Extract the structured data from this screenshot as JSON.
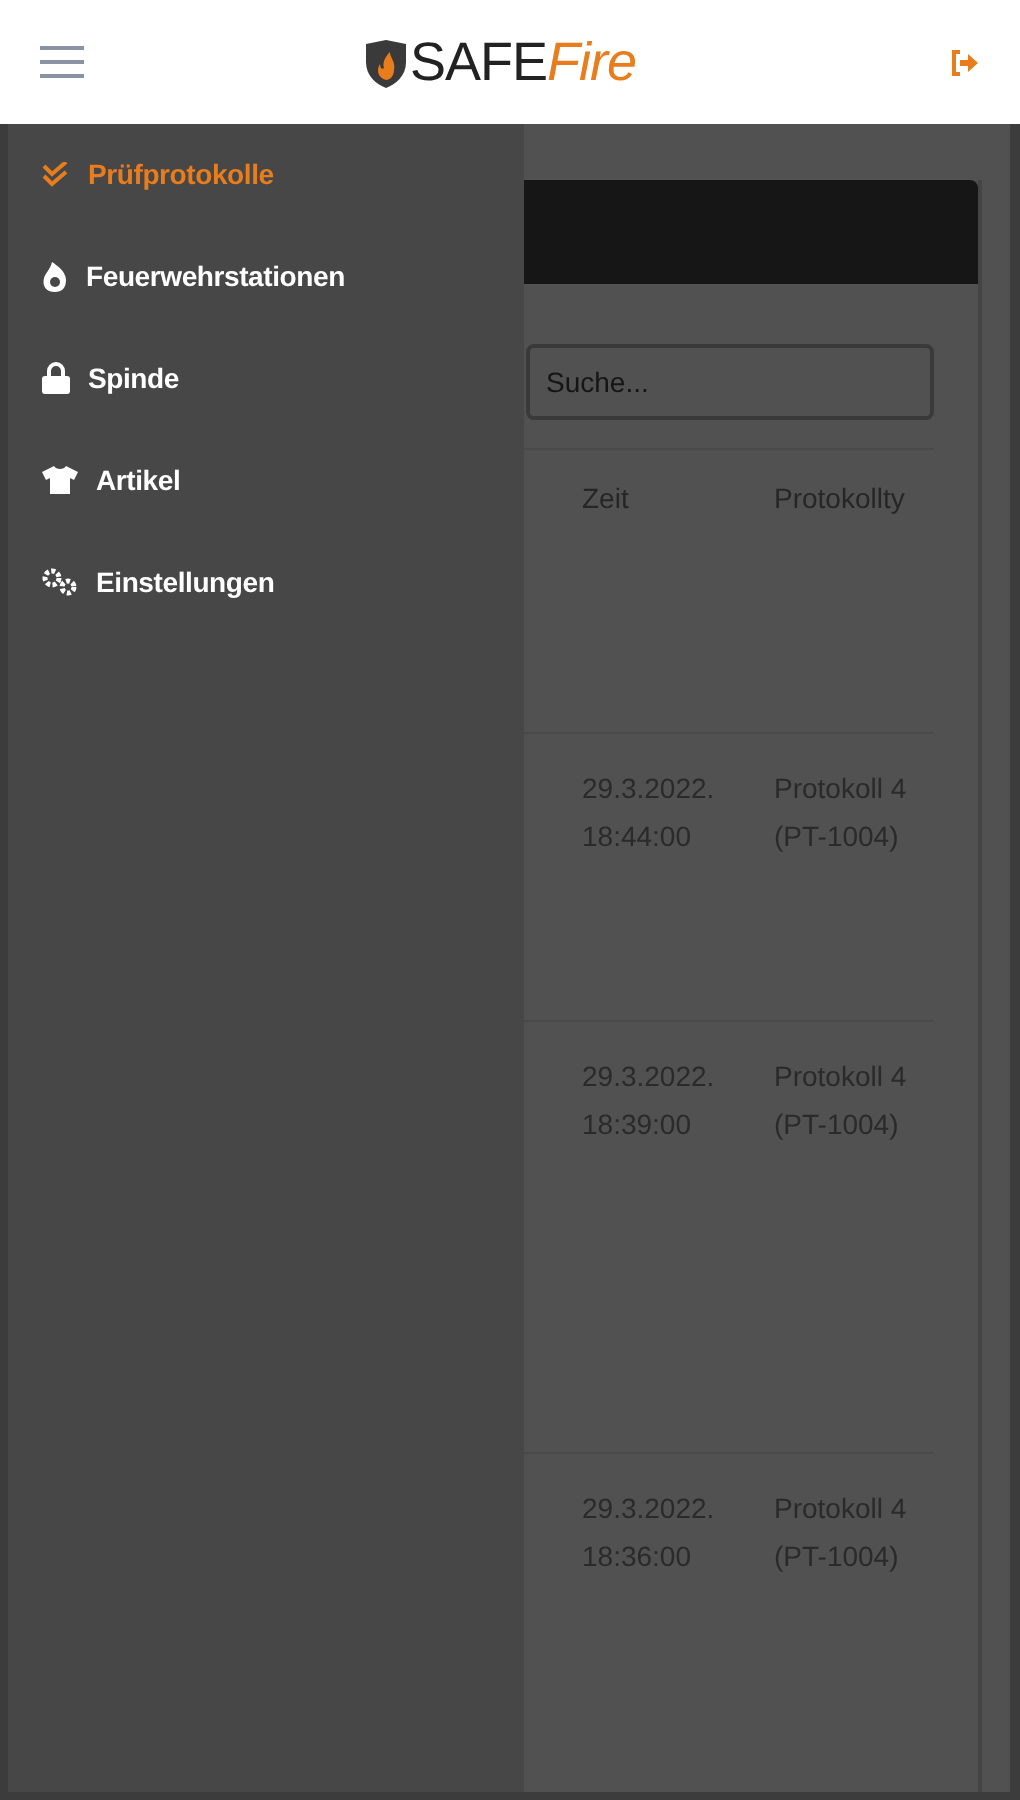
{
  "header": {
    "logo": {
      "main": "SAFE",
      "accent": "Fire"
    }
  },
  "drawer": {
    "items": [
      {
        "label": "Prüfprotokolle",
        "kind": "check",
        "selected": true
      },
      {
        "label": "Feuerwehrstationen",
        "kind": "fire",
        "selected": false
      },
      {
        "label": "Spinde",
        "kind": "lock",
        "selected": false
      },
      {
        "label": "Artikel",
        "kind": "shirt",
        "selected": false
      },
      {
        "label": "Einstellungen",
        "kind": "gears",
        "selected": false
      }
    ]
  },
  "content": {
    "search": {
      "placeholder": "Suche..."
    },
    "table": {
      "columns": [
        "Zeit",
        "Protokollty"
      ],
      "rows": [
        {
          "zeit": "29.3.2022. 18:44:00",
          "protokoll": "Protokoll 4 (PT-1004)"
        },
        {
          "zeit": "29.3.2022. 18:39:00",
          "protokoll": "Protokoll 4 (PT-1004)"
        },
        {
          "zeit": "29.3.2022. 18:36:00",
          "protokoll": "Protokoll 4 (PT-1004)"
        }
      ]
    }
  }
}
